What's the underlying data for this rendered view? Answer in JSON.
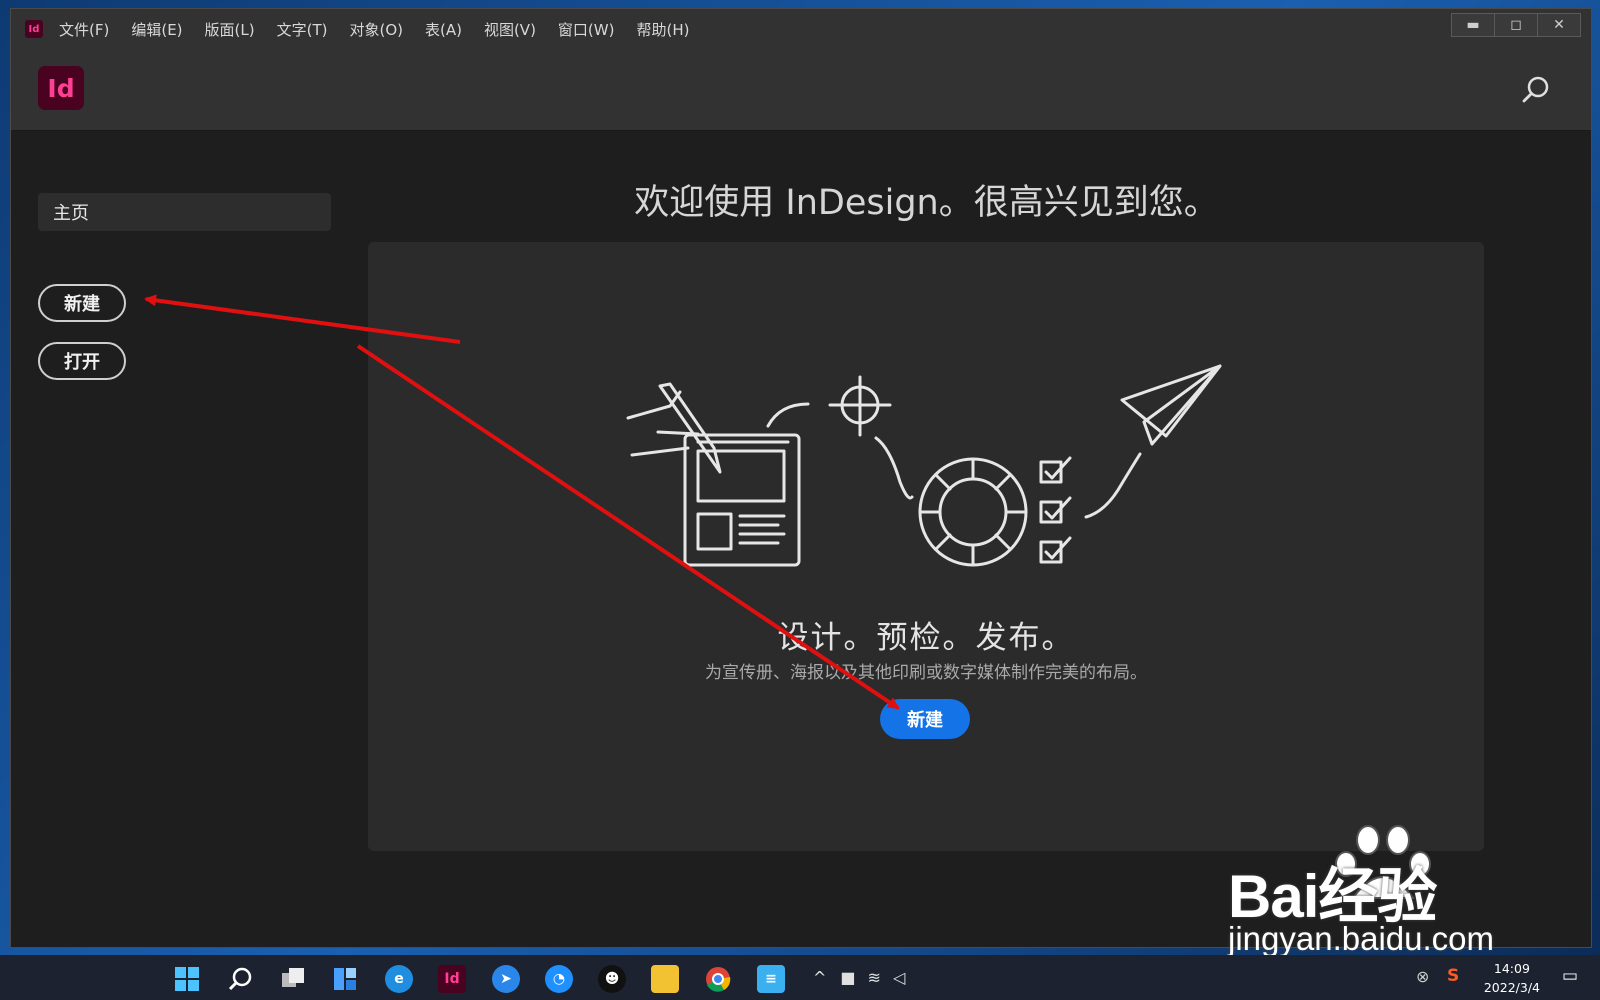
{
  "menubar": {
    "app_icon": "Id",
    "items": [
      "文件(F)",
      "编辑(E)",
      "版面(L)",
      "文字(T)",
      "对象(O)",
      "表(A)",
      "视图(V)",
      "窗口(W)",
      "帮助(H)"
    ],
    "controls": {
      "minimize": "▬",
      "maximize": "◻",
      "close": "✕"
    }
  },
  "header": {
    "logo": "Id",
    "search_icon": "search-icon"
  },
  "sidebar": {
    "home_label": "主页",
    "new_label": "新建",
    "open_label": "打开"
  },
  "main": {
    "welcome": "欢迎使用 InDesign。很高兴见到您。",
    "tagline": "设计。预检。发布。",
    "description": "为宣传册、海报以及其他印刷或数字媒体制作完美的布局。",
    "new_button": "新建"
  },
  "watermark": {
    "text": "Bai经验",
    "url": "jingyan.baidu.com"
  },
  "taskbar": {
    "icons": [
      "windows-start-icon",
      "search-icon",
      "task-view-icon",
      "widgets-icon",
      "edge-icon",
      "indesign-icon",
      "feishu-icon",
      "browser-icon",
      "qq-icon",
      "file-explorer-icon",
      "chrome-icon",
      "notepad-icon"
    ],
    "time": "14:09",
    "date": "2022/3/4"
  },
  "colors": {
    "accent": "#1473e6",
    "arrow": "#e01010",
    "id_brand": "#ff3f94",
    "id_bg": "#49021f"
  }
}
